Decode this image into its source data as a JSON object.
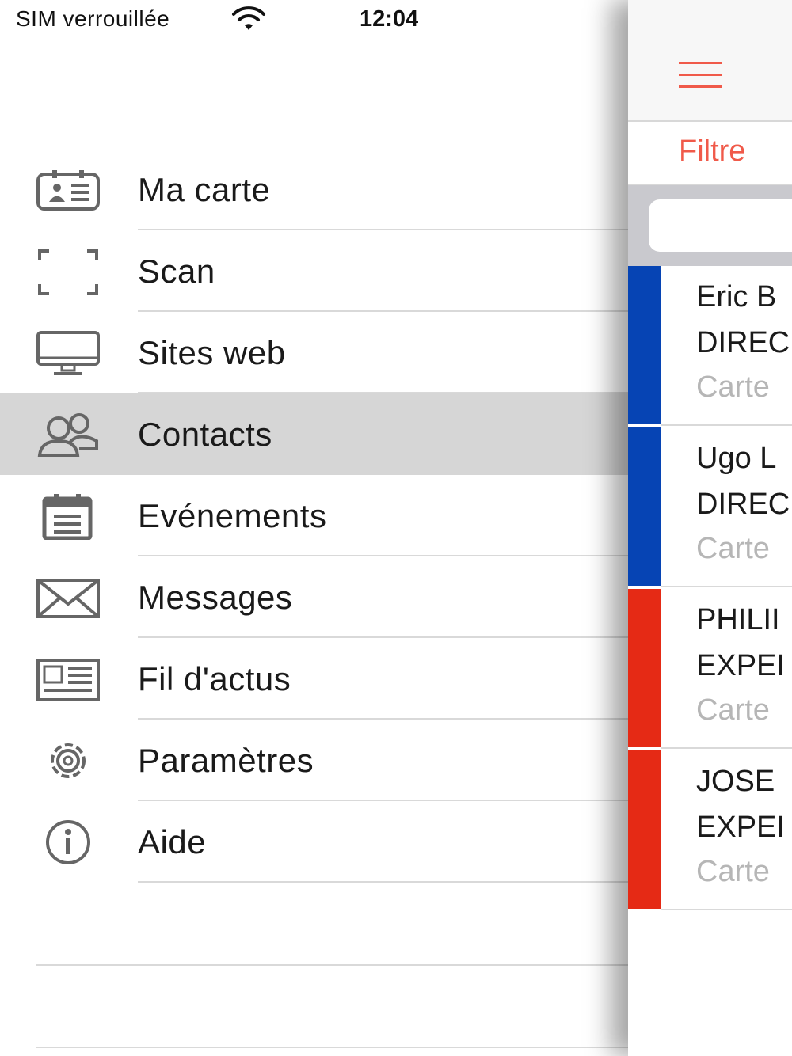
{
  "status": {
    "carrier": "SIM verrouillée",
    "time": "12:04"
  },
  "menu": {
    "items": [
      {
        "label": "Ma carte",
        "icon": "id-card-icon"
      },
      {
        "label": "Scan",
        "icon": "scan-frame-icon"
      },
      {
        "label": "Sites web",
        "icon": "monitor-icon"
      },
      {
        "label": "Contacts",
        "icon": "contacts-icon",
        "active": true
      },
      {
        "label": "Evénements",
        "icon": "calendar-icon"
      },
      {
        "label": "Messages",
        "icon": "envelope-icon"
      },
      {
        "label": "Fil d'actus",
        "icon": "newspaper-icon"
      },
      {
        "label": "Paramètres",
        "icon": "gear-icon"
      },
      {
        "label": "Aide",
        "icon": "info-icon"
      }
    ]
  },
  "panel": {
    "filter_label": "Filtre",
    "accent_color": "#f05a4a",
    "contacts": [
      {
        "name": "Eric B",
        "title": "DIREC",
        "card": "Carte",
        "color": "#0644b4"
      },
      {
        "name": "Ugo L",
        "title": "DIREC",
        "card": "Carte",
        "color": "#0644b4"
      },
      {
        "name": "PHILII",
        "title": "EXPEI",
        "card": "Carte",
        "color": "#e52a15"
      },
      {
        "name": "JOSE",
        "title": "EXPEI",
        "card": "Carte",
        "color": "#e52a15"
      }
    ]
  }
}
